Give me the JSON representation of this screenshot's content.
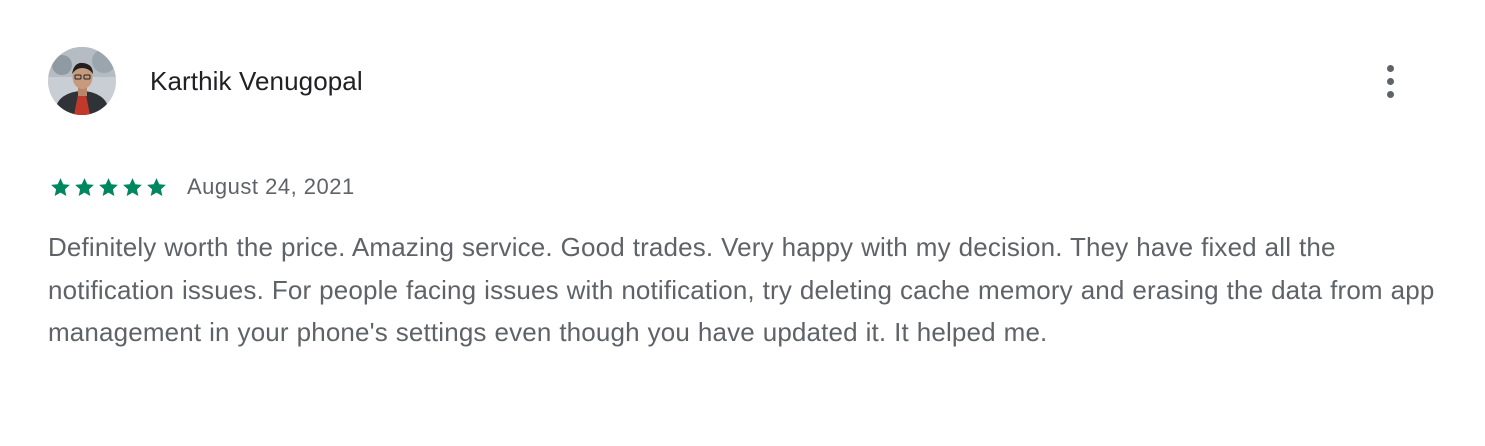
{
  "review": {
    "author_name": "Karthik Venugopal",
    "avatar": {
      "icon": "user-photo-avatar"
    },
    "more_options": {
      "icon": "more-vert-icon"
    },
    "rating": {
      "value": 5,
      "max": 5,
      "star_icon": "star-icon",
      "color": "#01875f"
    },
    "date": "August 24, 2021",
    "text": "Definitely worth the price. Amazing service. Good trades. Very happy with my decision. They have fixed all the notification issues. For people facing issues with notification, try deleting cache memory and erasing the data from app management in your phone's settings even though you have updated it. It helped me."
  },
  "colors": {
    "author_text": "#202124",
    "secondary_text": "#5f6368",
    "star": "#01875f",
    "icon": "#5f6368",
    "background": "#ffffff"
  }
}
